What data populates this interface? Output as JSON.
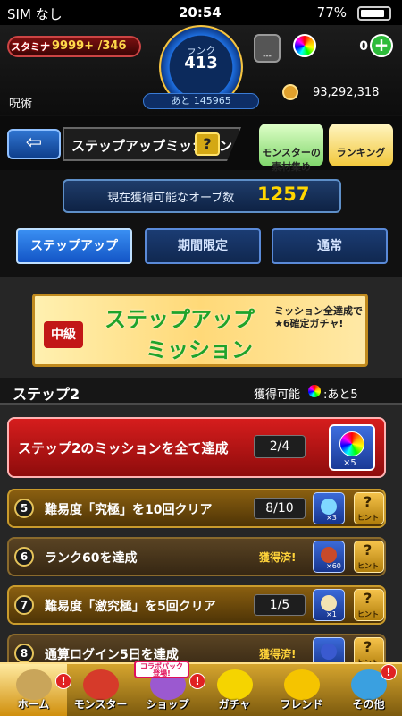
{
  "status_bar": {
    "carrier": "SIM なし",
    "time": "20:54",
    "battery": "77%",
    "battery_level": 0.77
  },
  "header": {
    "stamina_label": "スタミナ",
    "stamina_value": "9999+ /346",
    "rank_label": "ランク",
    "rank_value": "413",
    "next_rank": "あと 145965",
    "stage_label": "---",
    "orb_count": "0",
    "username": "呪術",
    "gold": "93,292,318"
  },
  "title_bar": {
    "back_icon": "arrow-left-icon",
    "title": "ステップアップミッション",
    "help": "?",
    "feature1": "モンスターの素材集め",
    "feature2": "ランキング"
  },
  "orb_panel": {
    "label": "現在獲得可能なオーブ数",
    "value": "1257"
  },
  "tabs": [
    {
      "label": "ステップアップ",
      "active": true
    },
    {
      "label": "期間限定",
      "active": false
    },
    {
      "label": "通常",
      "active": false
    }
  ],
  "banner": {
    "level": "中級",
    "title1": "ステップアップ",
    "title2": "ミッション",
    "sub1": "ミッション全達成で",
    "sub2": "★6確定ガチャ!"
  },
  "step": {
    "label": "ステップ2",
    "available_label": "獲得可能",
    "available_value": ":あと5"
  },
  "missions": {
    "main": {
      "text": "ステップ2のミッションを全て達成",
      "progress": "2/4",
      "reward_qty": "×5"
    },
    "items": [
      {
        "num": "5",
        "text": "難易度「究極」を10回クリア",
        "progress": "8/10",
        "done": false,
        "reward_qty": "×3",
        "hint": "ヒント",
        "reward_color": "#7fd8ff"
      },
      {
        "num": "6",
        "text": "ランク60を達成",
        "progress": "獲得済!",
        "done": true,
        "reward_qty": "×60",
        "hint": "ヒント",
        "reward_color": "#c84a2a"
      },
      {
        "num": "7",
        "text": "難易度「激究極」を5回クリア",
        "progress": "1/5",
        "done": false,
        "reward_qty": "×1",
        "hint": "ヒント",
        "reward_color": "#f3e3b2"
      },
      {
        "num": "8",
        "text": "通算ログイン5日を達成",
        "progress": "獲得済!",
        "done": true,
        "reward_qty": "",
        "hint": "ヒント",
        "reward_color": "#3a5ad0"
      }
    ]
  },
  "bottom_nav": {
    "items": [
      {
        "label": "ホーム",
        "icon": "home-icon"
      },
      {
        "label": "モンスター",
        "icon": "monster-icon"
      },
      {
        "label": "ショップ",
        "icon": "shop-icon"
      },
      {
        "label": "ガチャ",
        "icon": "gacha-icon"
      },
      {
        "label": "フレンド",
        "icon": "friend-icon"
      },
      {
        "label": "その他",
        "icon": "other-icon"
      }
    ],
    "collab_line1": "コラボパック",
    "collab_line2": "登場!",
    "badge": "!"
  }
}
